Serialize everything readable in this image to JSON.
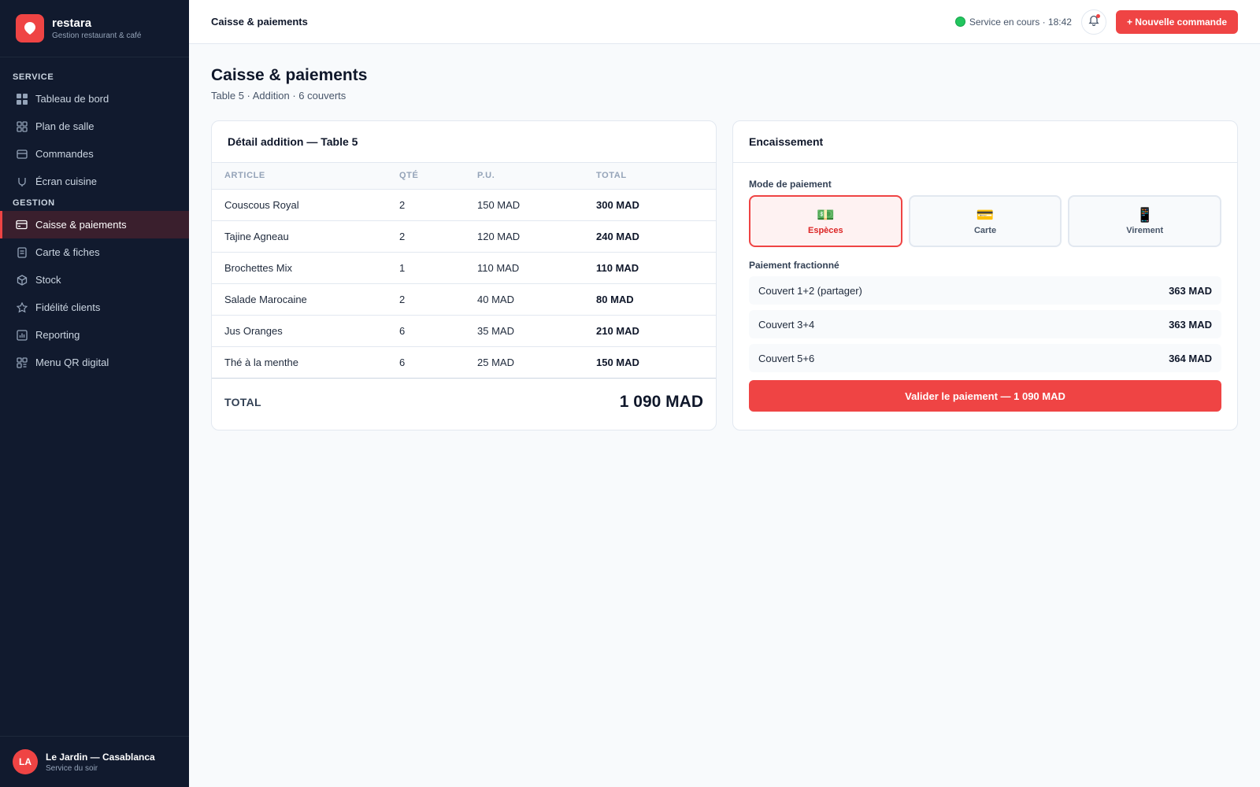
{
  "brand": {
    "name": "restara",
    "tagline": "Gestion restaurant & café",
    "logo_icon": "pin-icon"
  },
  "sidebar": {
    "sections": [
      {
        "title": "SERVICE",
        "items": [
          {
            "label": "Tableau de bord",
            "icon": "grid-icon"
          },
          {
            "label": "Plan de salle",
            "icon": "layout-icon"
          },
          {
            "label": "Commandes",
            "icon": "inbox-icon"
          },
          {
            "label": "Écran cuisine",
            "icon": "pot-icon"
          }
        ]
      },
      {
        "title": "GESTION",
        "items": [
          {
            "label": "Caisse & paiements",
            "icon": "card-icon",
            "active": true
          },
          {
            "label": "Carte & fiches",
            "icon": "document-icon"
          },
          {
            "label": "Stock",
            "icon": "box-icon"
          },
          {
            "label": "Fidélité clients",
            "icon": "star-icon"
          },
          {
            "label": "Reporting",
            "icon": "chart-icon"
          },
          {
            "label": "Menu QR digital",
            "icon": "qr-icon"
          }
        ]
      }
    ],
    "footer": {
      "initials": "LA",
      "name": "Le Jardin — Casablanca",
      "subtitle": "Service du soir"
    }
  },
  "topbar": {
    "title": "Caisse & paiements",
    "status": "Service en cours · 18:42",
    "new_order_label": "+ Nouvelle commande"
  },
  "page": {
    "title": "Caisse & paiements",
    "subtitle": "Table 5 · Addition · 6 couverts"
  },
  "bill": {
    "title": "Détail addition — Table 5",
    "columns": [
      "ARTICLE",
      "QTÉ",
      "P.U.",
      "TOTAL"
    ],
    "rows": [
      {
        "article": "Couscous Royal",
        "qty": "2",
        "unit": "150 MAD",
        "total": "300 MAD"
      },
      {
        "article": "Tajine Agneau",
        "qty": "2",
        "unit": "120 MAD",
        "total": "240 MAD"
      },
      {
        "article": "Brochettes Mix",
        "qty": "1",
        "unit": "110 MAD",
        "total": "110 MAD"
      },
      {
        "article": "Salade Marocaine",
        "qty": "2",
        "unit": "40 MAD",
        "total": "80 MAD"
      },
      {
        "article": "Jus Oranges",
        "qty": "6",
        "unit": "35 MAD",
        "total": "210 MAD"
      },
      {
        "article": "Thé à la menthe",
        "qty": "6",
        "unit": "25 MAD",
        "total": "150 MAD"
      }
    ],
    "total_label": "TOTAL",
    "total_value": "1 090 MAD"
  },
  "payment": {
    "title": "Encaissement",
    "mode_label": "Mode de paiement",
    "modes": [
      {
        "label": "Espèces",
        "icon": "💵",
        "selected": true
      },
      {
        "label": "Carte",
        "icon": "💳",
        "selected": false
      },
      {
        "label": "Virement",
        "icon": "📱",
        "selected": false
      }
    ],
    "split_label": "Paiement fractionné",
    "splits": [
      {
        "label": "Couvert 1+2 (partager)",
        "amount": "363 MAD"
      },
      {
        "label": "Couvert 3+4",
        "amount": "363 MAD"
      },
      {
        "label": "Couvert 5+6",
        "amount": "364 MAD"
      }
    ],
    "validate_label": "Valider le paiement — 1 090 MAD"
  },
  "colors": {
    "accent": "#ef4444",
    "sidebar_bg": "#111a2e",
    "status_green": "#22c55e"
  }
}
